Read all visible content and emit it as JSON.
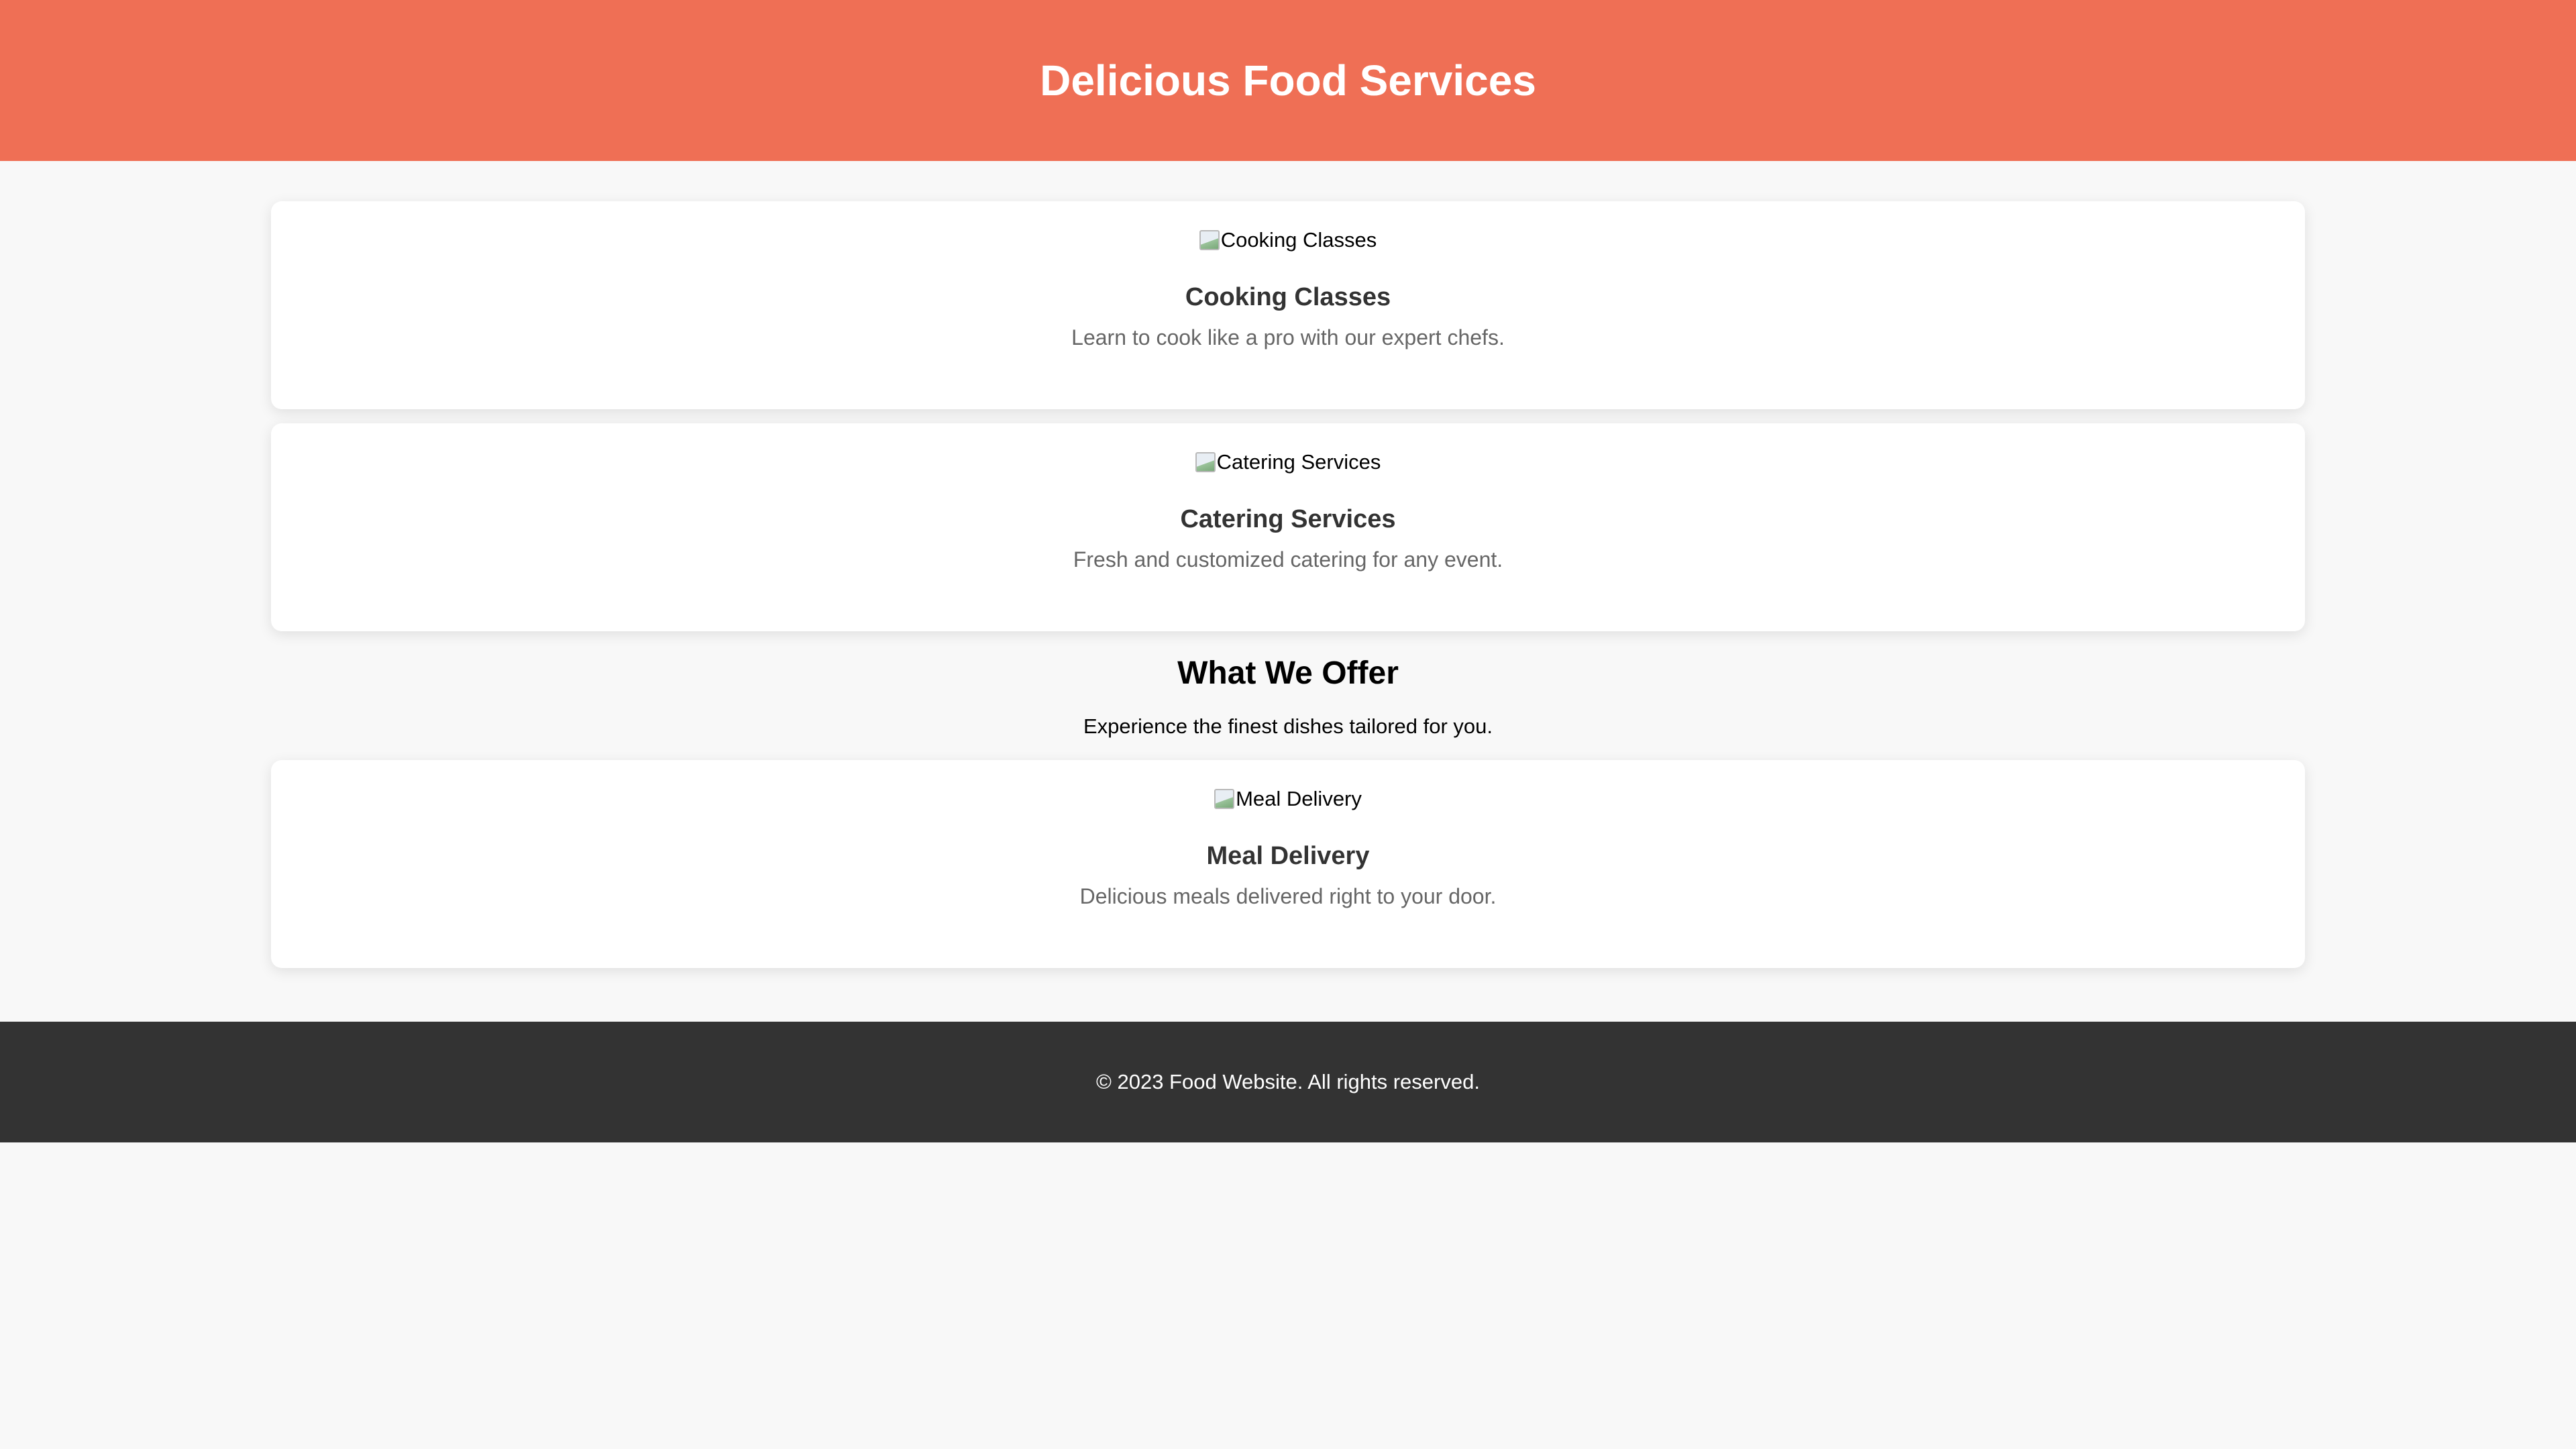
{
  "header": {
    "title": "Delicious Food Services"
  },
  "services_top": [
    {
      "image_alt": "Cooking Classes",
      "title": "Cooking Classes",
      "description": "Learn to cook like a pro with our expert chefs."
    },
    {
      "image_alt": "Catering Services",
      "title": "Catering Services",
      "description": "Fresh and customized catering for any event."
    }
  ],
  "offer": {
    "title": "What We Offer",
    "text": "Experience the finest dishes tailored for you."
  },
  "services_bottom": [
    {
      "image_alt": "Meal Delivery",
      "title": "Meal Delivery",
      "description": "Delicious meals delivered right to your door."
    }
  ],
  "footer": {
    "text": "© 2023 Food Website. All rights reserved."
  },
  "colors": {
    "header_bg": "#ef6f55",
    "page_bg": "#f8f8f8",
    "card_bg": "#ffffff",
    "footer_bg": "#333333"
  },
  "icons": {
    "card_image": "broken-image-icon"
  }
}
